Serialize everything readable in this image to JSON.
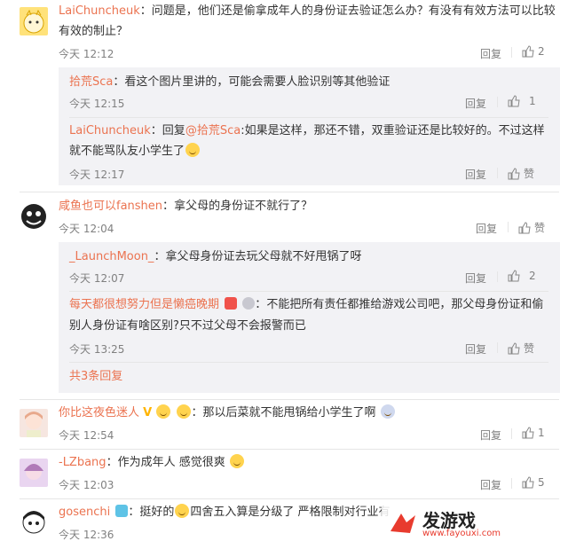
{
  "comments": [
    {
      "user": "LaiChuncheuk",
      "sep": "：",
      "line1": "问题是，他们还是偷拿成年人的身份证去验证怎么办？有没有有效方法可以比较",
      "line2": "有效的制止？",
      "time": "今天 12:12",
      "reply": "回复",
      "likes": "2"
    },
    {
      "user": "咸鱼也可以fanshen",
      "sep": "：",
      "line1": "拿父母的身份证不就行了？",
      "time": "今天 12:04",
      "reply": "回复",
      "likes": "赞"
    },
    {
      "user": "你比这夜色迷人",
      "sep": "：",
      "line1": "那以后菜就不能甩锅给小学生了啊",
      "time": "今天 12:54",
      "reply": "回复",
      "likes": "1"
    },
    {
      "user": "-LZbang",
      "sep": "：",
      "line1": "作为成年人 感觉很爽",
      "time": "今天 12:03",
      "reply": "回复",
      "likes": "5"
    },
    {
      "user": "gosenchi",
      "sep": "：",
      "line1": "挺好的",
      "line1b": "四舍五入算是分级了 严格限制对行业有",
      "time": "今天 12:36"
    }
  ],
  "subs1": [
    {
      "user": "拾荒Sca",
      "sep": "：",
      "line1": "看这个图片里讲的，可能会需要人脸识别等其他验证",
      "time": "今天 12:15",
      "reply": "回复",
      "likes": "1"
    },
    {
      "user": "LaiChuncheuk",
      "sep": "：",
      "pre": "回复",
      "mention": "@拾荒Sca",
      "line1": ":如果是这样，那还不错，双重验证还是比较好的。不过这样",
      "line2": "就不能骂队友小学生了",
      "time": "今天 12:17",
      "reply": "回复",
      "likes": "赞"
    }
  ],
  "subs2": [
    {
      "user": "_LaunchMoon_",
      "sep": "：",
      "line1": "拿父母身份证去玩父母就不好甩锅了呀",
      "time": "今天 12:07",
      "reply": "回复",
      "likes": "2"
    },
    {
      "user": "每天都很想努力但是懒癌晚期",
      "sep": "：",
      "line1": "不能把所有责任都推给游戏公司吧，那父母身份证和偷",
      "line2": "别人身份证有啥区别?只不过父母不会报警而已",
      "time": "今天 13:25",
      "reply": "回复",
      "likes": "赞"
    }
  ],
  "more_replies": "共3条回复",
  "watermark": {
    "brand": "发游戏",
    "url": "www.fayouxi.com"
  },
  "colors": {
    "name": "#eb7350",
    "sub_bg": "#f2f2f5",
    "meta": "#808080"
  }
}
